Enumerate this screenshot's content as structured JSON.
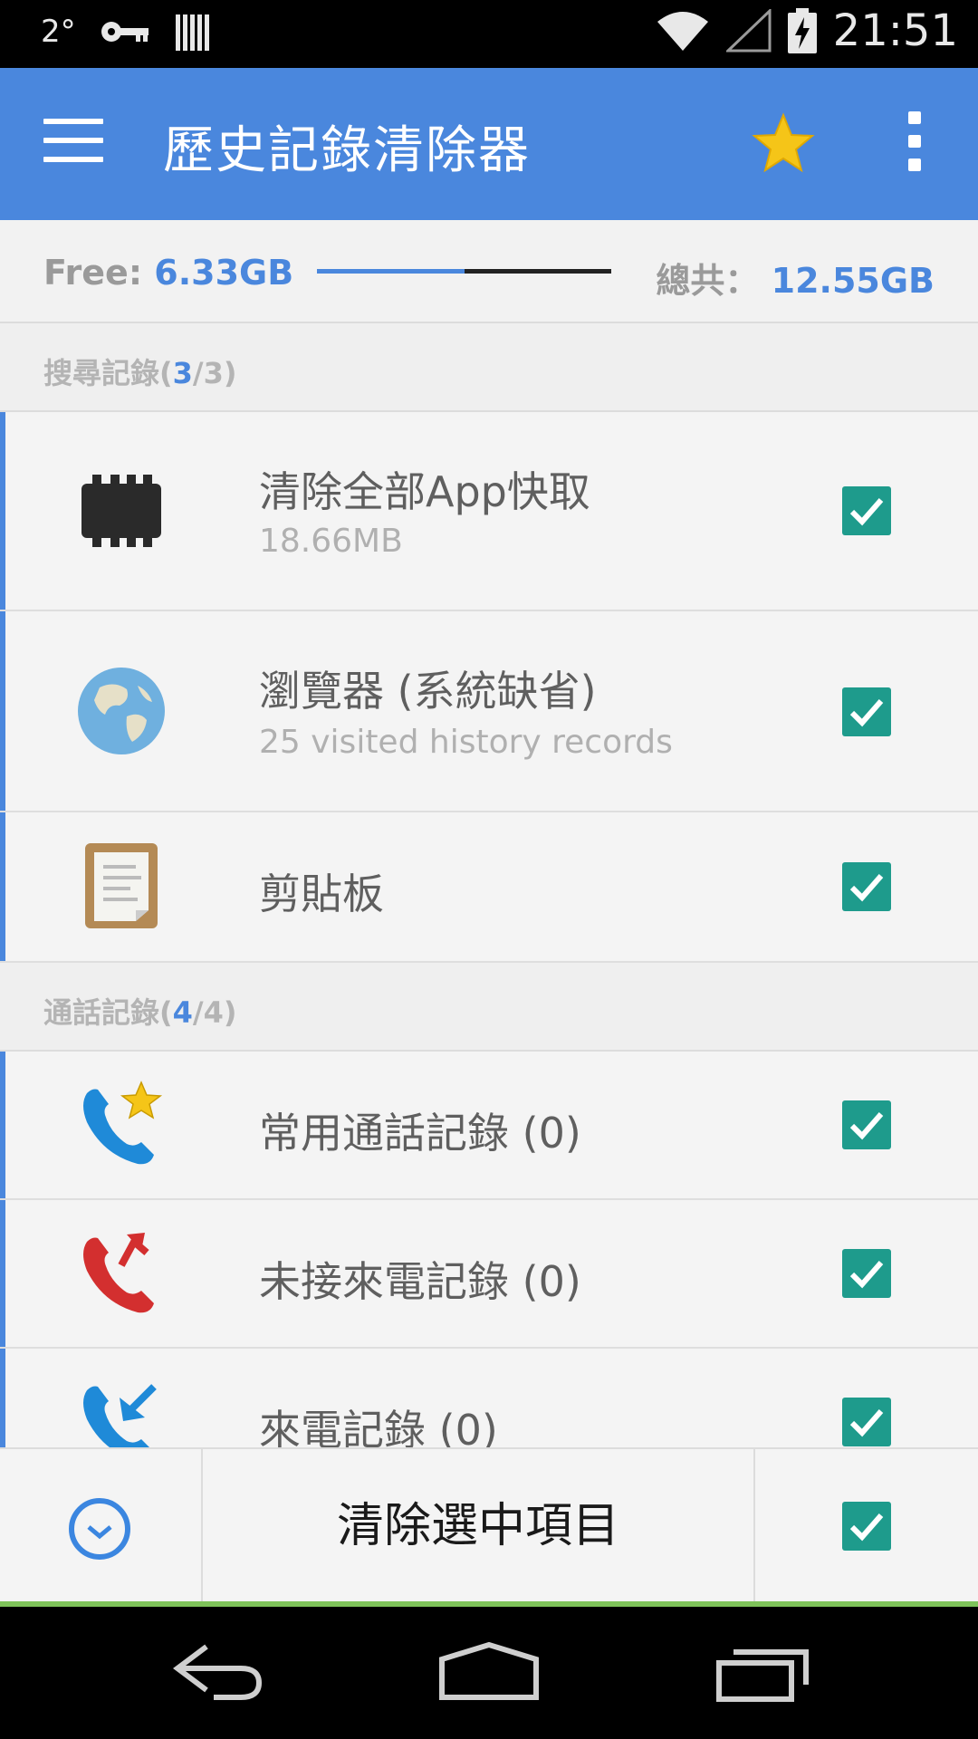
{
  "status_bar": {
    "temperature": "2°",
    "time": "21:51"
  },
  "app_bar": {
    "title": "歷史記錄清除器",
    "icons": [
      "menu-icon",
      "star-icon",
      "overflow-menu-icon"
    ],
    "accent_color": "#4a87dd"
  },
  "storage": {
    "free_label": "Free: ",
    "free_value": "6.33GB",
    "total_label": "總共：",
    "total_value": "12.55GB",
    "used_fraction": 0.5
  },
  "sections": [
    {
      "title": "搜尋記錄",
      "count_selected": "3",
      "count_total": "/3",
      "items": [
        {
          "icon": "chip-icon",
          "title": "清除全部App快取",
          "subtitle": "18.66MB",
          "checked": true
        },
        {
          "icon": "globe-icon",
          "title": "瀏覽器 (系統缺省)",
          "subtitle": "25 visited history records",
          "checked": true
        },
        {
          "icon": "clipboard-icon",
          "title": "剪貼板",
          "subtitle": "",
          "checked": true
        }
      ]
    },
    {
      "title": "通話記錄",
      "count_selected": "4",
      "count_total": "/4",
      "items": [
        {
          "icon": "favorite-call-icon",
          "title": "常用通話記錄 (0)",
          "checked": true
        },
        {
          "icon": "missed-call-icon",
          "title": "未接來電記錄 (0)",
          "checked": true
        },
        {
          "icon": "incoming-call-icon",
          "title": "來電記錄 (0)",
          "checked": true
        }
      ]
    }
  ],
  "action_bar": {
    "clean_label": "清除選中項目",
    "schedule_icon": "clock-icon",
    "select_all_checked": true
  },
  "nav_bar": {
    "icons": [
      "back-icon",
      "home-icon",
      "recents-icon"
    ]
  },
  "colors": {
    "checkbox": "#1e9b8c",
    "progress_line": "#7fc35a"
  }
}
